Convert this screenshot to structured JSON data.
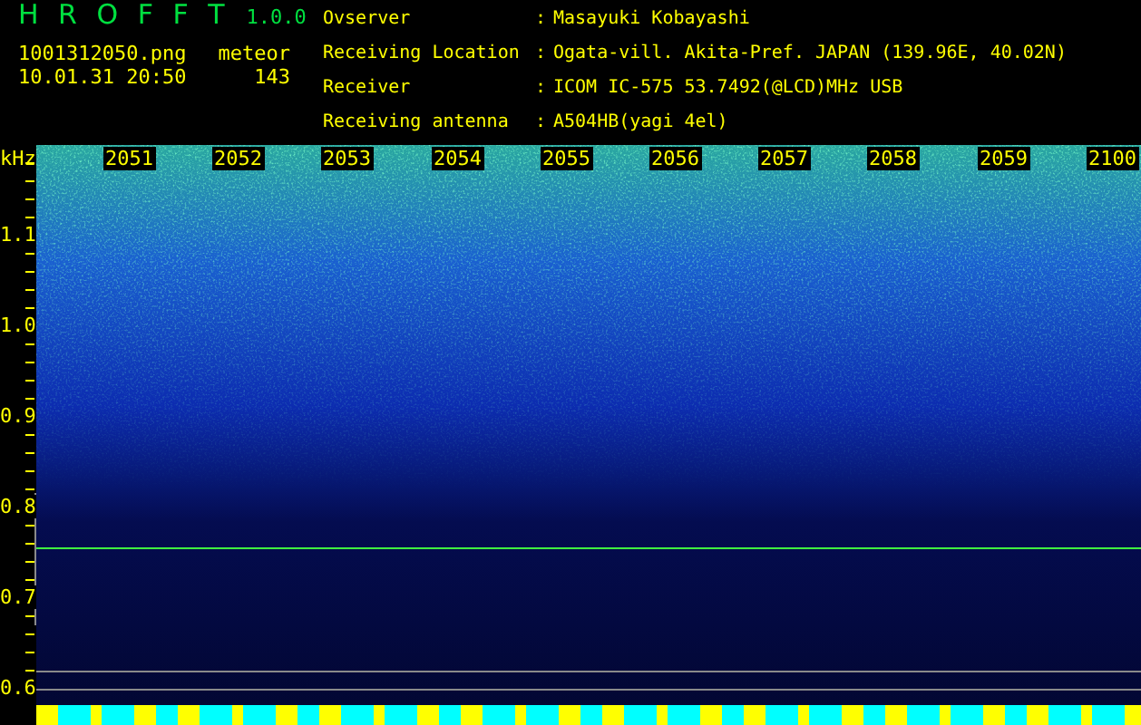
{
  "app": {
    "name": "H R O F F T",
    "version": "1.0.0"
  },
  "file": {
    "name": "1001312050.png",
    "datetime": "10.01.31 20:50"
  },
  "meteor": {
    "label": "meteor",
    "count": "143"
  },
  "info": [
    {
      "label": "Ovserver",
      "separator": ":",
      "value": "Masayuki Kobayashi"
    },
    {
      "label": "Receiving Location",
      "separator": ":",
      "value": "Ogata-vill. Akita-Pref. JAPAN (139.96E, 40.02N)"
    },
    {
      "label": "Receiver",
      "separator": ":",
      "value": "ICOM IC-575 53.7492(@LCD)MHz USB"
    },
    {
      "label": "Receiving antenna",
      "separator": ":",
      "value": "A504HB(yagi 4el)"
    }
  ],
  "spectrogram": {
    "unit": "kHz",
    "time_labels": [
      "2051",
      "2052",
      "2053",
      "2054",
      "2055",
      "2056",
      "2057",
      "2058",
      "2059",
      "2100"
    ],
    "freq_labels": [
      "1.1",
      "1.0",
      "0.9",
      "0.8",
      "0.7",
      "0.6"
    ]
  }
}
